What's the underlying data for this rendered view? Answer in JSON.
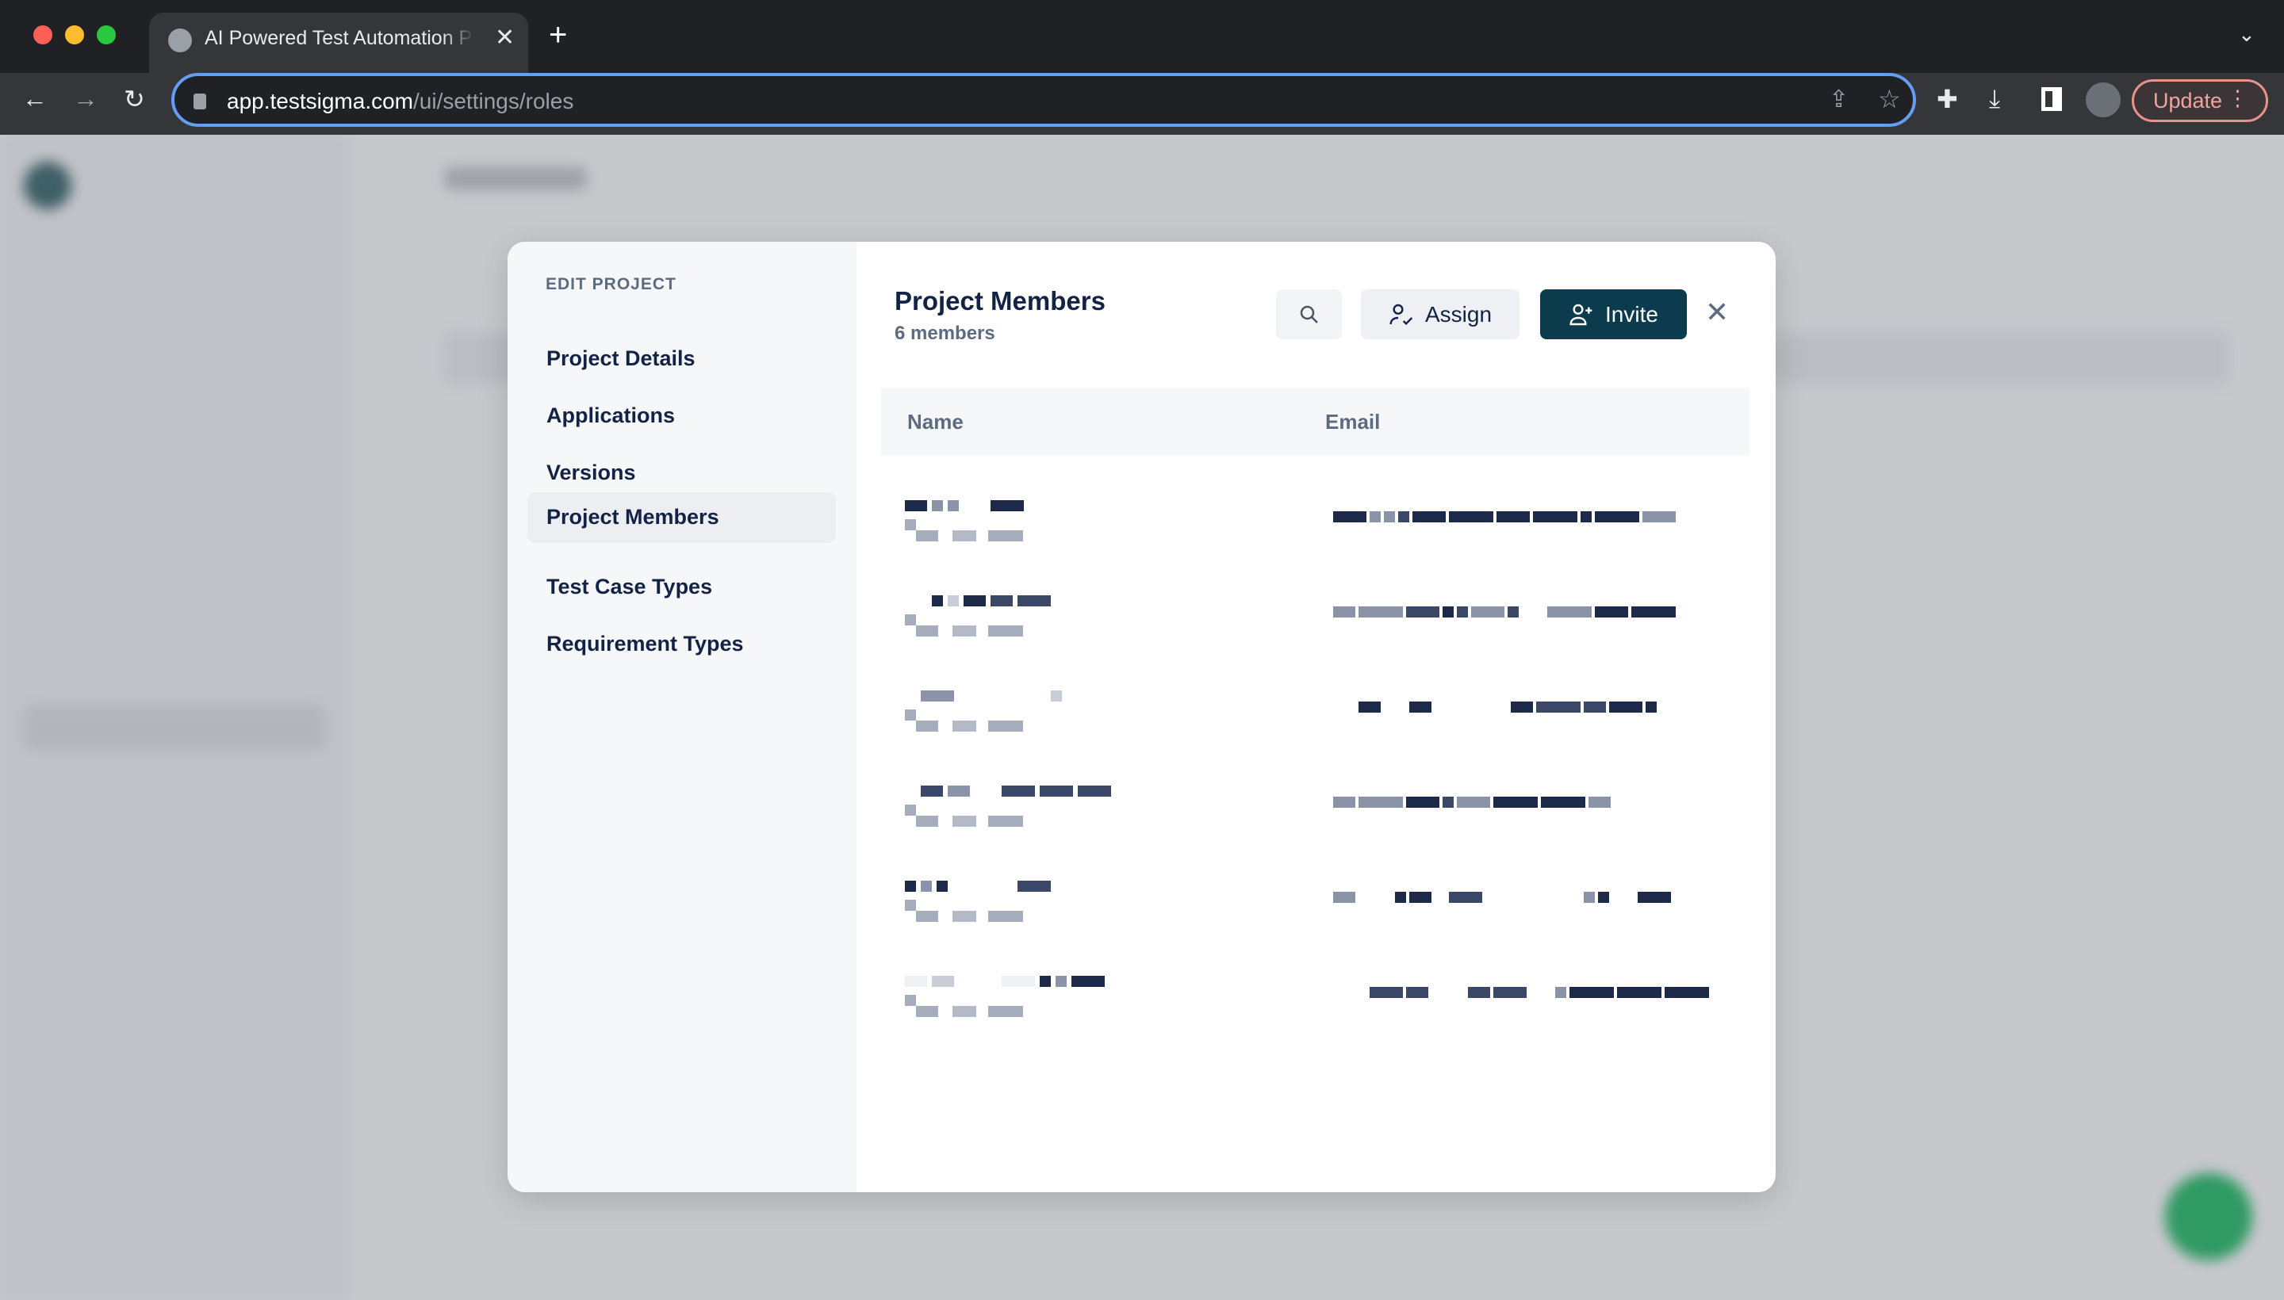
{
  "browser": {
    "tab_title": "AI Powered Test Automation Platform",
    "url_host": "app.testsigma.com",
    "url_path": "/ui/settings/roles",
    "update_label": "Update"
  },
  "modal": {
    "sidebar": {
      "heading": "EDIT PROJECT",
      "items": [
        {
          "label": "Project Details"
        },
        {
          "label": "Applications"
        },
        {
          "label": "Versions"
        },
        {
          "label": "Project Members",
          "active": true
        },
        {
          "label": "Test Case Types"
        },
        {
          "label": "Requirement Types"
        }
      ]
    },
    "title": "Project Members",
    "member_count": "6 members",
    "assign_label": "Assign",
    "invite_label": "Invite",
    "table": {
      "columns": [
        "Name",
        "Email"
      ],
      "rows_obscured": 6
    },
    "colors": {
      "primary": "#0b3b4d",
      "text": "#132345",
      "muted": "#5d6b82"
    }
  }
}
